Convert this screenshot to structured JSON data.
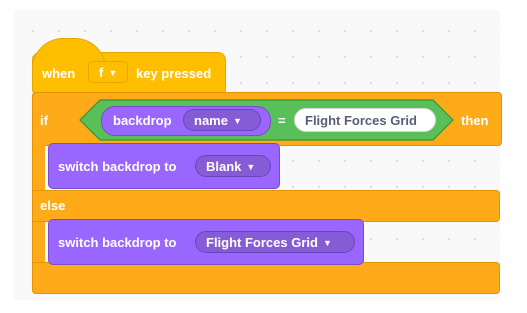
{
  "hat": {
    "when": "when",
    "key": "f",
    "key_pressed": "key pressed"
  },
  "if_block": {
    "if": "if",
    "then": "then",
    "else": "else"
  },
  "condition": {
    "backdrop": "backdrop",
    "property": "name",
    "equals": "=",
    "value": "Flight Forces Grid"
  },
  "then_branch": {
    "label": "switch backdrop to",
    "value": "Blank"
  },
  "else_branch": {
    "label": "switch backdrop to",
    "value": "Flight Forces Grid"
  },
  "colors": {
    "events": "#ffbf00",
    "control": "#ffab19",
    "looks": "#9966ff",
    "operators": "#59c059",
    "sensing": "#5cb1d6"
  }
}
